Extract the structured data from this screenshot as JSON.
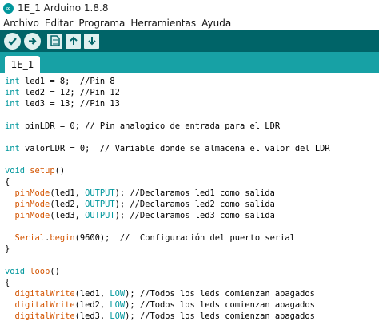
{
  "window": {
    "title": "1E_1 Arduino 1.8.8"
  },
  "menu": [
    "Archivo",
    "Editar",
    "Programa",
    "Herramientas",
    "Ayuda"
  ],
  "toolbar": {
    "buttons": [
      "verify",
      "upload",
      "new",
      "open",
      "save"
    ]
  },
  "tabs": [
    {
      "label": "1E_1"
    }
  ],
  "code": {
    "l1": {
      "type": "int",
      "rest": " led1 = 8;  //Pin 8"
    },
    "l2": {
      "type": "int",
      "rest": " led2 = 12; //Pin 12"
    },
    "l3": {
      "type": "int",
      "rest": " led3 = 13; //Pin 13"
    },
    "l4": {
      "type": "int",
      "rest": " pinLDR = 0; // Pin analogico de entrada para el LDR"
    },
    "l5": {
      "type": "int",
      "rest": " valorLDR = 0;  // Variable donde se almacena el valor del LDR"
    },
    "l6": {
      "type": "void",
      "name": "setup",
      "rest": "()"
    },
    "brace_open": "{",
    "brace_close": "}",
    "s1": {
      "fn": "pinMode",
      "a": "(led1, ",
      "c": "OUTPUT",
      "rest": "); //Declaramos led1 como salida"
    },
    "s2": {
      "fn": "pinMode",
      "a": "(led2, ",
      "c": "OUTPUT",
      "rest": "); //Declaramos led2 como salida"
    },
    "s3": {
      "fn": "pinMode",
      "a": "(led3, ",
      "c": "OUTPUT",
      "rest": "); //Declaramos led3 como salida"
    },
    "s4": {
      "obj": "Serial",
      "dot": ".",
      "fn": "begin",
      "rest": "(9600);  //  Configuración del puerto serial"
    },
    "l7": {
      "type": "void",
      "name": "loop",
      "rest": "()"
    },
    "d1": {
      "fn": "digitalWrite",
      "a": "(led1, ",
      "c": "LOW",
      "rest": "); //Todos los leds comienzan apagados"
    },
    "d2": {
      "fn": "digitalWrite",
      "a": "(led2, ",
      "c": "LOW",
      "rest": "); //Todos los leds comienzan apagados"
    },
    "d3": {
      "fn": "digitalWrite",
      "a": "(led3, ",
      "c": "LOW",
      "rest": "); //Todos los leds comienzan apagados"
    }
  },
  "colors": {
    "toolbar": "#006468",
    "tabbar": "#17a1a5",
    "keyword": "#00979c",
    "function": "#d35400"
  }
}
